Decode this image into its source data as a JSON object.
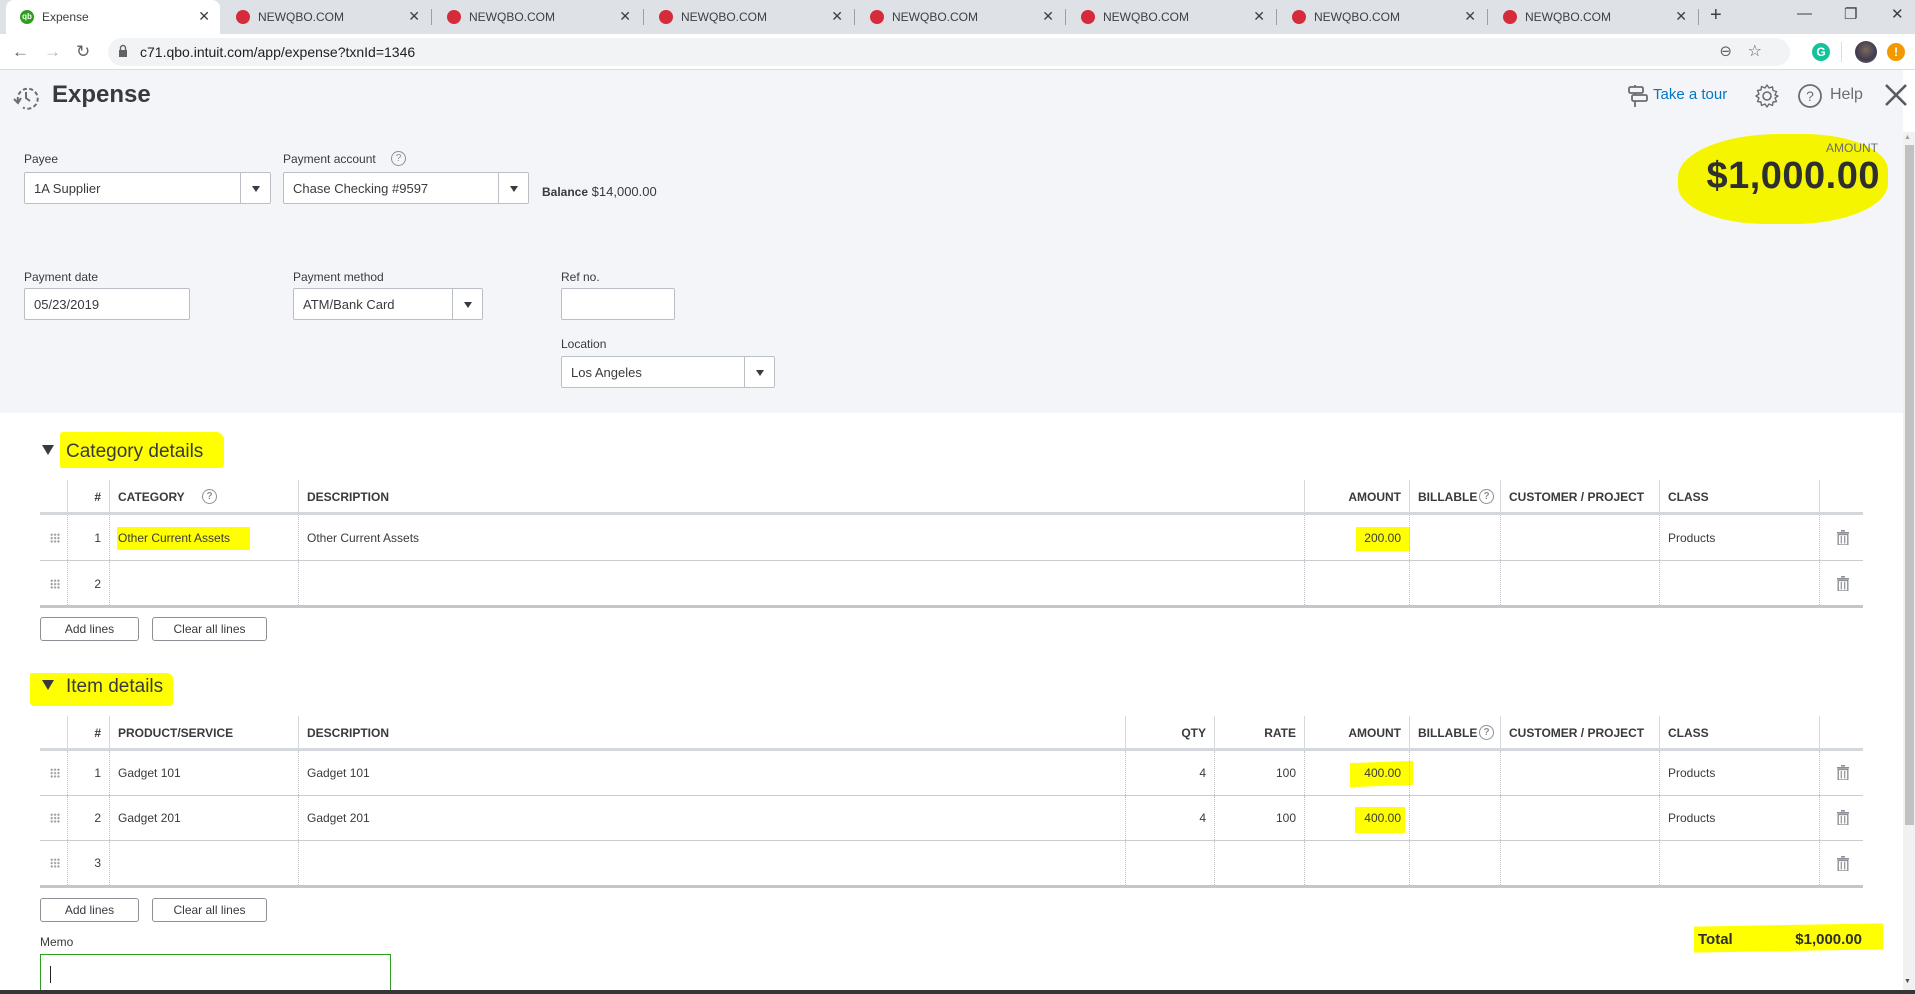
{
  "browser": {
    "tabs": [
      {
        "label": "Expense",
        "favicon": "quickbooks-icon",
        "active": true
      },
      {
        "label": "NEWQBO.COM",
        "favicon": "newqbo-icon",
        "active": false
      },
      {
        "label": "NEWQBO.COM",
        "favicon": "newqbo-icon",
        "active": false
      },
      {
        "label": "NEWQBO.COM",
        "favicon": "newqbo-icon",
        "active": false
      },
      {
        "label": "NEWQBO.COM",
        "favicon": "newqbo-icon",
        "active": false
      },
      {
        "label": "NEWQBO.COM",
        "favicon": "newqbo-icon",
        "active": false
      },
      {
        "label": "NEWQBO.COM",
        "favicon": "newqbo-icon",
        "active": false
      },
      {
        "label": "NEWQBO.COM",
        "favicon": "newqbo-icon",
        "active": false
      }
    ],
    "url": "c71.qbo.intuit.com/app/expense?txnId=1346",
    "grammarly_letter": "G",
    "alert_symbol": "!"
  },
  "header": {
    "title": "Expense",
    "take_tour": "Take a tour",
    "help": "Help",
    "amount_label": "AMOUNT",
    "amount_value": "$1,000.00"
  },
  "form": {
    "payee": {
      "label": "Payee",
      "value": "1A Supplier"
    },
    "payment_account": {
      "label": "Payment account",
      "value": "Chase Checking #9597"
    },
    "balance": {
      "label": "Balance",
      "value": "$14,000.00"
    },
    "payment_date": {
      "label": "Payment date",
      "value": "05/23/2019"
    },
    "payment_method": {
      "label": "Payment method",
      "value": "ATM/Bank Card"
    },
    "ref_no": {
      "label": "Ref no.",
      "value": ""
    },
    "location": {
      "label": "Location",
      "value": "Los Angeles"
    }
  },
  "category_details": {
    "title": "Category details",
    "columns": [
      "#",
      "CATEGORY",
      "DESCRIPTION",
      "AMOUNT",
      "BILLABLE",
      "CUSTOMER / PROJECT",
      "CLASS"
    ],
    "rows": [
      {
        "num": "1",
        "category": "Other Current Assets",
        "description": "Other Current Assets",
        "amount": "200.00",
        "billable": "",
        "customer": "",
        "class": "Products"
      },
      {
        "num": "2",
        "category": "",
        "description": "",
        "amount": "",
        "billable": "",
        "customer": "",
        "class": ""
      }
    ],
    "add_lines": "Add lines",
    "clear_lines": "Clear all lines"
  },
  "item_details": {
    "title": "Item details",
    "columns": [
      "#",
      "PRODUCT/SERVICE",
      "DESCRIPTION",
      "QTY",
      "RATE",
      "AMOUNT",
      "BILLABLE",
      "CUSTOMER / PROJECT",
      "CLASS"
    ],
    "rows": [
      {
        "num": "1",
        "product": "Gadget 101",
        "description": "Gadget 101",
        "qty": "4",
        "rate": "100",
        "amount": "400.00",
        "billable": "",
        "customer": "",
        "class": "Products"
      },
      {
        "num": "2",
        "product": "Gadget 201",
        "description": "Gadget 201",
        "qty": "4",
        "rate": "100",
        "amount": "400.00",
        "billable": "",
        "customer": "",
        "class": "Products"
      },
      {
        "num": "3",
        "product": "",
        "description": "",
        "qty": "",
        "rate": "",
        "amount": "",
        "billable": "",
        "customer": "",
        "class": ""
      }
    ],
    "add_lines": "Add lines",
    "clear_lines": "Clear all lines"
  },
  "memo": {
    "label": "Memo",
    "value": ""
  },
  "total": {
    "label": "Total",
    "value": "$1,000.00"
  },
  "colors": {
    "accent_green": "#2ca01c",
    "link_blue": "#0077c5",
    "highlight": "#ffff00",
    "newqbo_red": "#d52b3a"
  }
}
